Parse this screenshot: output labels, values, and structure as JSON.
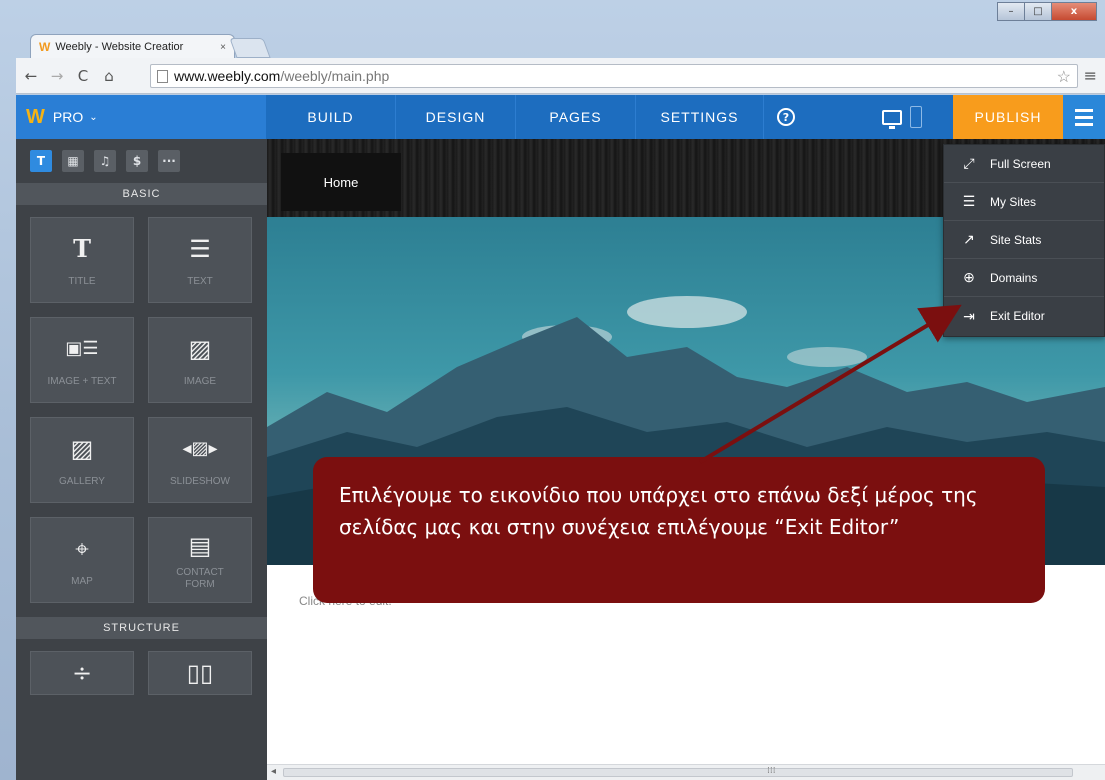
{
  "browser": {
    "tab_title": "Weebly - Website Creatior",
    "tab_close": "×",
    "favicon": "W",
    "url_host": "www.weebly.com",
    "url_path": "/weebly/main.php",
    "win_min": "–",
    "win_max": "□",
    "win_close": "x"
  },
  "topbar": {
    "logo": "W",
    "plan": "PRO",
    "plan_chevron": "⌄",
    "tabs": [
      {
        "label": "BUILD"
      },
      {
        "label": "DESIGN"
      },
      {
        "label": "PAGES"
      },
      {
        "label": "SETTINGS"
      }
    ],
    "help": "?",
    "publish": "PUBLISH"
  },
  "sidebar": {
    "categories": [
      {
        "glyph": "T",
        "active": true
      },
      {
        "glyph": "▦"
      },
      {
        "glyph": "♫"
      },
      {
        "glyph": "$"
      },
      {
        "glyph": "···"
      }
    ],
    "basic_heading": "BASIC",
    "basic_tiles": [
      {
        "icon": "T",
        "label": "TITLE"
      },
      {
        "icon": "☰",
        "label": "TEXT"
      },
      {
        "icon": "▣☰",
        "label": "IMAGE + TEXT"
      },
      {
        "icon": "▨",
        "label": "IMAGE"
      },
      {
        "icon": "▨",
        "label": "GALLERY"
      },
      {
        "icon": "◂▨▸",
        "label": "SLIDESHOW"
      },
      {
        "icon": "⌖",
        "label": "MAP"
      },
      {
        "icon": "▤",
        "label": "CONTACT FORM"
      }
    ],
    "structure_heading": "STRUCTURE",
    "structure_tiles": [
      {
        "icon": "÷"
      },
      {
        "icon": "▯▯"
      }
    ]
  },
  "canvas": {
    "nav_home": "Home",
    "body_placeholder": "Click here to edit."
  },
  "menu": {
    "items": [
      {
        "icon": "⤢",
        "label": "Full Screen"
      },
      {
        "icon": "☰",
        "label": "My Sites"
      },
      {
        "icon": "↗",
        "label": "Site Stats"
      },
      {
        "icon": "⊕",
        "label": "Domains"
      },
      {
        "icon": "⇥",
        "label": "Exit Editor"
      }
    ]
  },
  "callout": {
    "text": "Επιλέγουμε το εικονίδιο που υπάρχει στο επάνω δεξί μέρος της σελίδας μας και στην συνέχεια επιλέγουμε “Exit Editor”"
  },
  "colors": {
    "topbar": "#1d6dbf",
    "publish": "#f89c1c",
    "callout": "#7b0f0f",
    "sidebar": "#3e4247"
  }
}
